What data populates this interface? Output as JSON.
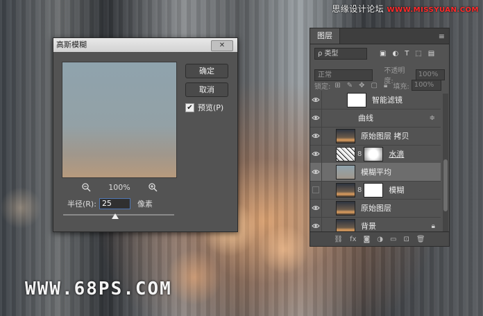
{
  "watermark_top": {
    "text": "思缘设计论坛 ",
    "site": "WWW.MISSYUAN.COM"
  },
  "watermark_bottom": "WWW.68PS.COM",
  "dialog": {
    "title": "高斯模糊",
    "close_label": "✕",
    "ok_label": "确定",
    "cancel_label": "取消",
    "preview_label": "预览(P)",
    "preview_checked": true,
    "zoom_level": "100%",
    "radius_label": "半径(R):",
    "radius_value": "25",
    "radius_unit": "像素",
    "slider_position": 0.47
  },
  "layers_panel": {
    "tab_label": "图层",
    "menu_icon": "≡",
    "filter_kind": "ρ 类型",
    "blend_mode": "正常",
    "opacity_label": "不透明度:",
    "opacity_value": "100%",
    "lock_label": "锁定:",
    "fill_label": "填充:",
    "fill_value": "100%",
    "layers": [
      {
        "name": "智能滤镜",
        "visible": true,
        "thumb": "white",
        "indent": true
      },
      {
        "name": "曲线",
        "visible": true,
        "thumb": "none",
        "indent": true,
        "icon": "≑"
      },
      {
        "name": "原始图层 拷贝",
        "visible": true,
        "thumb": "photo"
      },
      {
        "name": "水滴",
        "visible": true,
        "thumb": "noise",
        "mask": true
      },
      {
        "name": "模糊平均",
        "visible": true,
        "thumb": "blur",
        "selected": true
      },
      {
        "name": "模糊",
        "visible": false,
        "thumb": "photo",
        "mask": true
      },
      {
        "name": "原始图层",
        "visible": true,
        "thumb": "photo"
      },
      {
        "name": "背景",
        "visible": true,
        "thumb": "photo",
        "locked": true
      }
    ]
  }
}
